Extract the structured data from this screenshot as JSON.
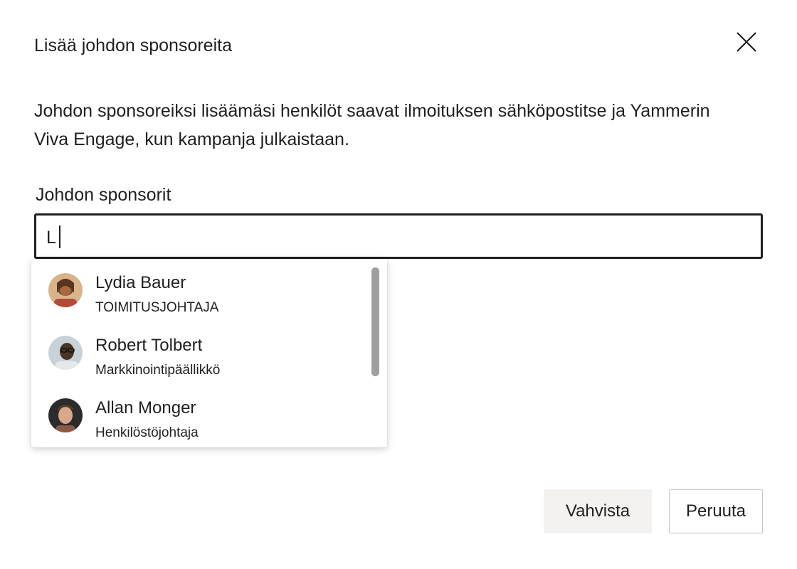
{
  "dialog": {
    "title": "Lisää johdon sponsoreita",
    "description": "Johdon sponsoreiksi lisäämäsi henkilöt saavat ilmoituksen sähköpostitse ja Yammerin Viva Engage, kun kampanja julkaistaan.",
    "close_icon": "close-icon"
  },
  "sponsor_field": {
    "label": "Johdon sponsorit",
    "value": "L"
  },
  "suggestions": [
    {
      "name": "Lydia Bauer",
      "role": "TOIMITUSJOHTAJA",
      "avatar_icon": "avatar-lydia-bauer"
    },
    {
      "name": "Robert Tolbert",
      "role": "Markkinointipäällikkö",
      "avatar_icon": "avatar-robert-tolbert"
    },
    {
      "name": "Allan Monger",
      "role": "Henkilöstöjohtaja",
      "avatar_icon": "avatar-allan-monger"
    }
  ],
  "buttons": {
    "confirm_label": "Vahvista",
    "cancel_label": "Peruuta"
  },
  "colors": {
    "text": "#201f1e",
    "confirm_bg": "#f3f2f1",
    "cancel_border": "#c8c6c4",
    "scrollbar": "#a19f9d"
  }
}
